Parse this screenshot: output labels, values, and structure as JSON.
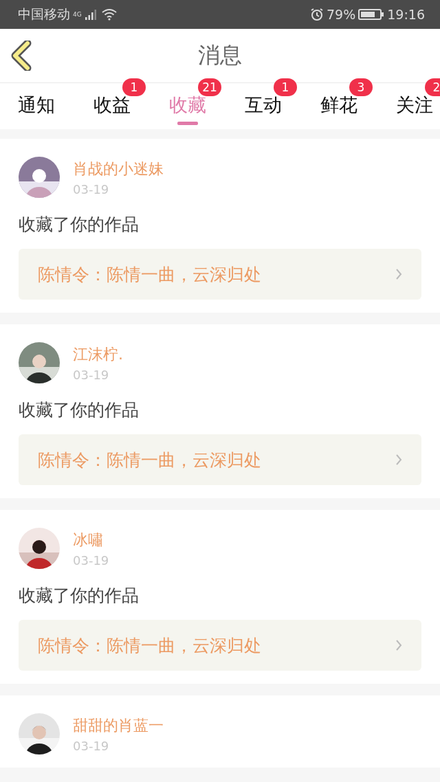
{
  "status_bar": {
    "carrier": "中国移动",
    "network": "4G",
    "battery": "79%",
    "time": "19:16"
  },
  "header": {
    "title": "消息"
  },
  "tabs": [
    {
      "label": "通知",
      "selected": false
    },
    {
      "label": "收益",
      "badge": "1",
      "selected": false
    },
    {
      "label": "收藏",
      "badge": "21",
      "selected": true
    },
    {
      "label": "互动",
      "badge": "1",
      "selected": false
    },
    {
      "label": "鲜花",
      "badge": "3",
      "selected": false
    },
    {
      "label": "关注",
      "badge": "2",
      "selected": false
    }
  ],
  "messages": [
    {
      "user": "肖战的小迷妹",
      "date": "03-19",
      "action": "收藏了你的作品",
      "work": "陈情令：陈情一曲，云深归处"
    },
    {
      "user": "江沫柠.",
      "date": "03-19",
      "action": "收藏了你的作品",
      "work": "陈情令：陈情一曲，云深归处"
    },
    {
      "user": "冰嘯",
      "date": "03-19",
      "action": "收藏了你的作品",
      "work": "陈情令：陈情一曲，云深归处"
    },
    {
      "user": "甜甜的肖蓝一",
      "date": "03-19"
    }
  ]
}
